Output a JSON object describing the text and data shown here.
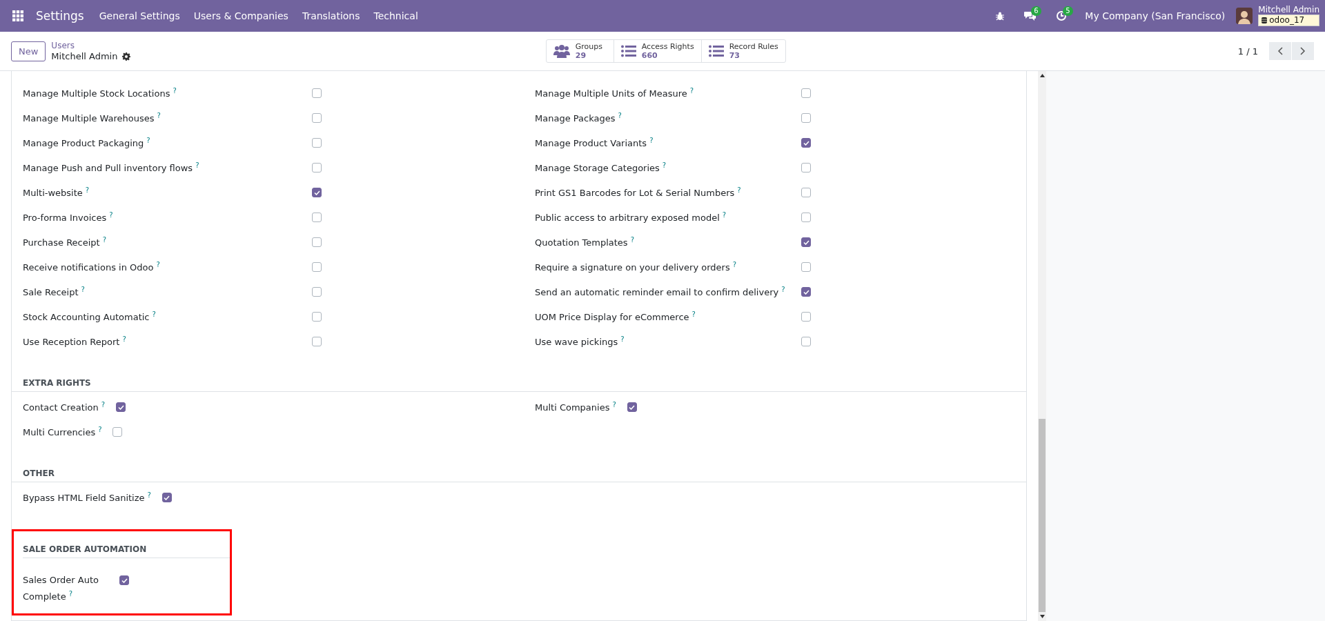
{
  "navbar": {
    "app": "Settings",
    "menus": [
      "General Settings",
      "Users & Companies",
      "Translations",
      "Technical"
    ],
    "messages_count": "6",
    "activities_count": "5",
    "company": "My Company (San Francisco)",
    "user": "Mitchell Admin",
    "database": "odoo_17"
  },
  "control_panel": {
    "new_button": "New",
    "breadcrumb": "Users",
    "record": "Mitchell Admin",
    "smart_buttons": [
      {
        "kind": "groups",
        "label": "Groups",
        "count": "29"
      },
      {
        "kind": "list",
        "label": "Access Rights",
        "count": "660"
      },
      {
        "kind": "list",
        "label": "Record Rules",
        "count": "73"
      }
    ],
    "pager": "1 / 1"
  },
  "sections": [
    {
      "kind": "two",
      "fields": [
        {
          "label": "Manage Multiple Stock Locations",
          "help": "?",
          "checked": false
        },
        {
          "label": "Manage Multiple Units of Measure",
          "help": "?",
          "checked": false
        },
        {
          "label": "Manage Multiple Warehouses",
          "help": "?",
          "checked": false
        },
        {
          "label": "Manage Packages",
          "help": "?",
          "checked": false
        },
        {
          "label": "Manage Product Packaging",
          "help": "?",
          "checked": false
        },
        {
          "label": "Manage Product Variants",
          "help": "?",
          "checked": true
        },
        {
          "label": "Manage Push and Pull inventory flows",
          "help": "?",
          "checked": false
        },
        {
          "label": "Manage Storage Categories",
          "help": "?",
          "checked": false
        },
        {
          "label": "Multi-website",
          "help": "?",
          "checked": true
        },
        {
          "label": "Print GS1 Barcodes for Lot & Serial Numbers",
          "help": "?",
          "checked": false
        },
        {
          "label": "Pro-forma Invoices",
          "help": "?",
          "checked": false
        },
        {
          "label": "Public access to arbitrary exposed model",
          "help": "?",
          "checked": false
        },
        {
          "label": "Purchase Receipt",
          "help": "?",
          "checked": false
        },
        {
          "label": "Quotation Templates",
          "help": "?",
          "checked": true
        },
        {
          "label": "Receive notifications in Odoo",
          "help": "?",
          "checked": false
        },
        {
          "label": "Require a signature on your delivery orders",
          "help": "?",
          "checked": false
        },
        {
          "label": "Sale Receipt",
          "help": "?",
          "checked": false
        },
        {
          "label": "Send an automatic reminder email to confirm delivery",
          "help": "?",
          "checked": true
        },
        {
          "label": "Stock Accounting Automatic",
          "help": "?",
          "checked": false
        },
        {
          "label": "UOM Price Display for eCommerce",
          "help": "?",
          "checked": false
        },
        {
          "label": "Use Reception Report",
          "help": "?",
          "checked": false
        },
        {
          "label": "Use wave pickings",
          "help": "?",
          "checked": false
        }
      ]
    },
    {
      "title": "EXTRA RIGHTS",
      "kind": "inline",
      "fields": [
        {
          "label": "Contact Creation",
          "help": "?",
          "checked": true
        },
        {
          "label": "Multi Companies",
          "help": "?",
          "checked": true
        },
        {
          "label": "Multi Currencies",
          "help": "?",
          "checked": false
        }
      ]
    },
    {
      "title": "OTHER",
      "kind": "inline",
      "fields": [
        {
          "label": "Bypass HTML Field Sanitize",
          "help": "?",
          "checked": true
        }
      ]
    },
    {
      "title": "SALE ORDER AUTOMATION",
      "kind": "highlight",
      "fields": [
        {
          "label": "Sales Order Auto Complete",
          "help": "?",
          "checked": true
        }
      ]
    }
  ]
}
